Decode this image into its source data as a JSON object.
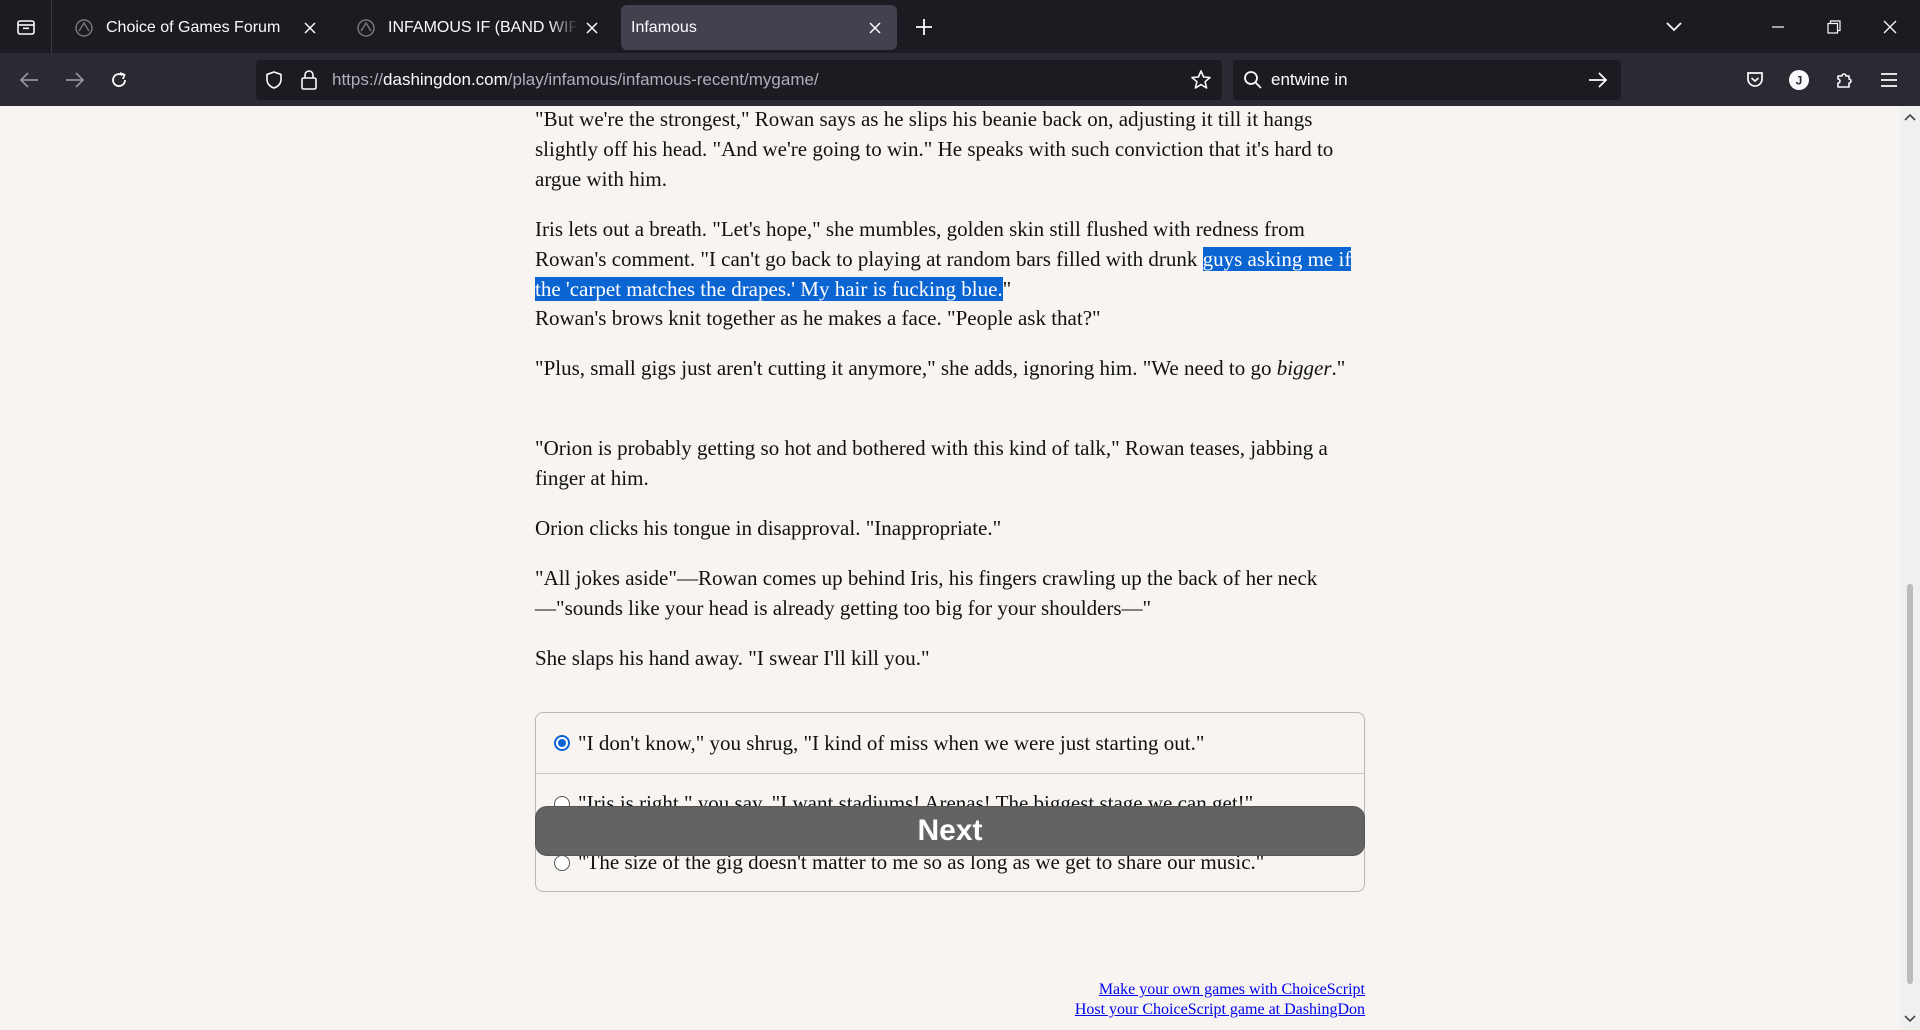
{
  "browser": {
    "tabs": [
      {
        "title": "Choice of Games Forum",
        "active": false
      },
      {
        "title": "INFAMOUS IF (BAND WIP) CHAPTER",
        "active": false
      },
      {
        "title": "Infamous",
        "active": true
      }
    ],
    "url_prefix": "https://",
    "url_host": "dashingdon.com",
    "url_path": "/play/infamous/infamous-recent/mygame/",
    "search_query": "entwine in",
    "accent_color": "#0a64d2"
  },
  "story": {
    "p1": "\"But we're the strongest,\" Rowan says as he slips his beanie back on, adjusting it till it hangs slightly off his head. \"And we're going to win.\" He speaks with such conviction that it's hard to argue with him.",
    "p2_before": "Iris lets out a breath. \"Let's hope,\" she mumbles, golden skin still flushed with redness from Rowan's comment. \"I can't go back to playing at random bars filled with drunk ",
    "p2_selected": "guys asking me if the 'carpet matches the drapes.' My hair is fucking blue.",
    "p2_after": "\"",
    "p3": "Rowan's brows knit together as he makes a face. \"People ask that?\"",
    "p4_before": "\"Plus, small gigs just aren't cutting it anymore,\" she adds, ignoring him. \"We need to go ",
    "p4_em": "bigger",
    "p4_after": ".\"",
    "p5": "\"Orion is probably getting so hot and bothered with this kind of talk,\" Rowan teases, jabbing a finger at him.",
    "p6": "Orion clicks his tongue in disapproval. \"Inappropriate.\"",
    "p7": "\"All jokes aside\"—Rowan comes up behind Iris, his fingers crawling up the back of her neck —\"sounds like your head is already getting too big for your shoulders—\"",
    "p8": "She slaps his hand away. \"I swear I'll kill you.\""
  },
  "choices": [
    {
      "label": "\"I don't know,\" you shrug, \"I kind of miss when we were just starting out.\"",
      "selected": true
    },
    {
      "label": "\"Iris is right,\" you say, \"I want stadiums! Arenas! The biggest stage we can get!\"",
      "selected": false
    },
    {
      "label": "\"The size of the gig doesn't matter to me so as long as we get to share our music.\"",
      "selected": false
    }
  ],
  "next_label": "Next",
  "footer": {
    "link1": "Make your own games with ChoiceScript",
    "link2": "Host your ChoiceScript game at DashingDon"
  }
}
